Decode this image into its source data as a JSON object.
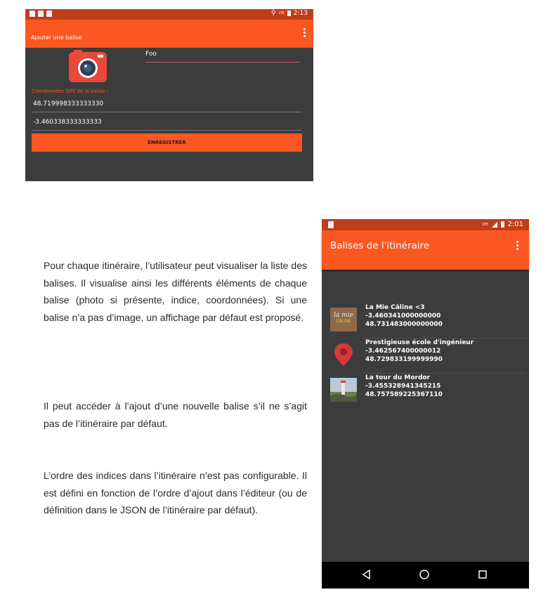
{
  "add_beacon_screen": {
    "status": {
      "time": "2:13",
      "network": "LTE"
    },
    "toolbar": {
      "title": "Ajouter une balise",
      "menu_icon": "more-vert-icon"
    },
    "camera_icon": "camera-icon",
    "name_value": "Foo",
    "gps_label": "Coordonnées GPS de la balise :",
    "latitude_value": "48.719998333333330",
    "longitude_value": "-3.460338333333333",
    "save_label": "ENREGISTRER"
  },
  "beacons_screen": {
    "status": {
      "time": "2:01",
      "network": "LTE"
    },
    "toolbar": {
      "title": "Balises de l'itinéraire",
      "menu_icon": "more-vert-icon"
    },
    "items": [
      {
        "name": "La Mie Câline <3",
        "line2": "-3.460341000000000",
        "line3": "48.731483000000000",
        "thumb": "la-mie-caline-logo",
        "logo_text_1": "la mie",
        "logo_text_2": "CÂLINE"
      },
      {
        "name": "Prestigieuse école d'ingénieur",
        "line2": "-3.462567400000012",
        "line3": "48.729833199999990",
        "thumb": "map-pin-icon"
      },
      {
        "name": "La tour du Mordor",
        "line2": "-3.455328941345215",
        "line3": "48.757589225367110",
        "thumb": "tower-photo"
      }
    ],
    "nav": {
      "back": "back-triangle-icon",
      "home": "home-circle-icon",
      "recents": "recents-square-icon"
    }
  },
  "text": {
    "p1": "Pour chaque itinéraire, l’utilisateur peut visualiser la liste des balises. Il visualise ainsi les différents éléments de chaque balise (photo si présente, indice, coordonnées). Si une balise n’a pas d’image, un affichage par défaut est proposé.",
    "p2": " Il peut accéder à l’ajout d’une nouvelle balise s’il ne s’agit pas de l’itinéraire par défaut.",
    "p3": "L’ordre des indices dans l’itinéraire n’est pas configurable. Il est défini en fonction de l’ordre d’ajout dans l’éditeur (ou de définition dans le JSON de l’itinéraire par défaut)."
  },
  "colors": {
    "accent": "#fc5722",
    "status_bar": "#c03d19",
    "background": "#3c3c3c",
    "input_underline": "#e94a7a"
  }
}
